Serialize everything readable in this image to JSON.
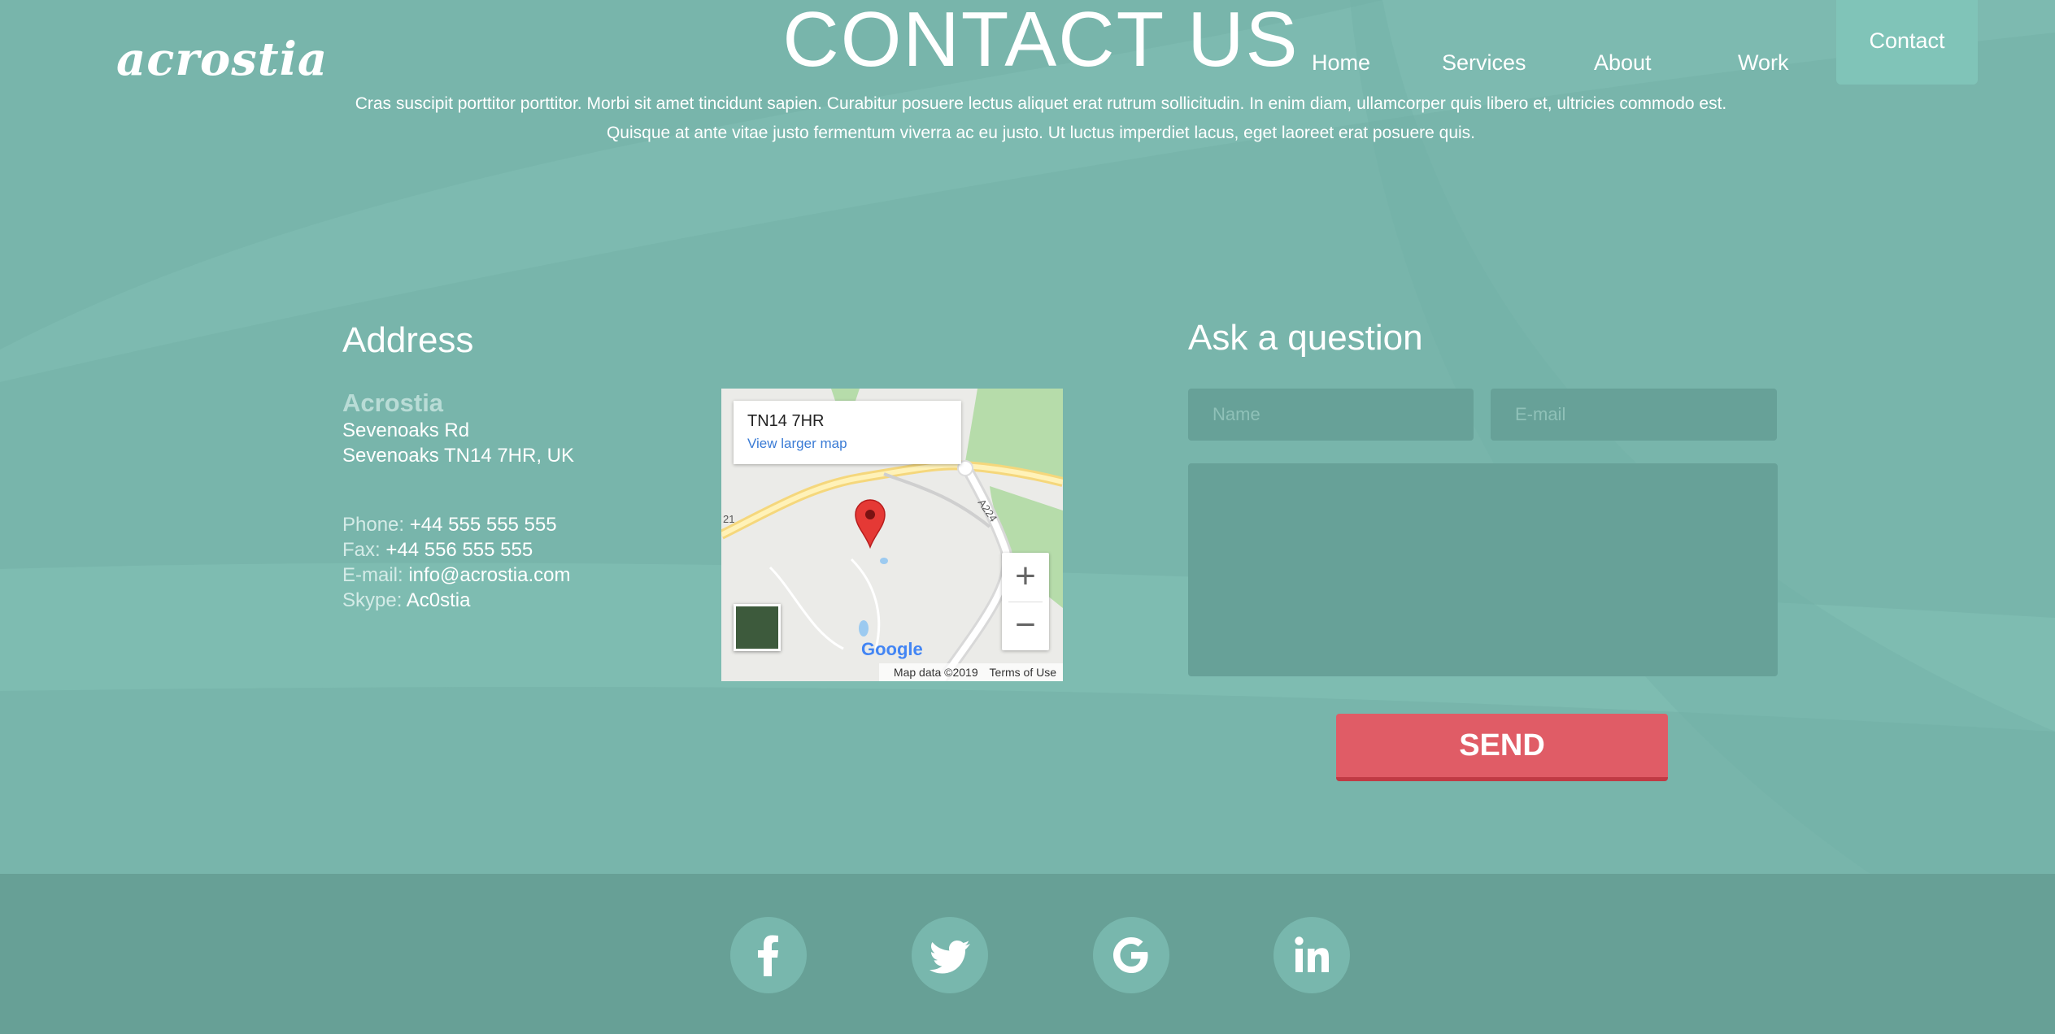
{
  "header": {
    "logo": "acrostia",
    "title": "CONTACT US",
    "intro_line1": "Cras suscipit porttitor porttitor. Morbi sit amet tincidunt sapien. Curabitur posuere lectus aliquet erat rutrum sollicitudin. In enim diam, ullamcorper quis libero et, ultricies commodo est.",
    "intro_line2": "Quisque at ante vitae justo fermentum viverra ac eu justo. Ut luctus imperdiet lacus, eget laoreet erat posuere quis."
  },
  "nav": {
    "items": [
      "Home",
      "Services",
      "About",
      "Work"
    ],
    "active": "Contact"
  },
  "address": {
    "heading": "Address",
    "company": "Acrostia",
    "street": "Sevenoaks Rd",
    "city": "Sevenoaks TN14 7HR, UK",
    "phone_label": "Phone:",
    "phone": "+44 555 555 555",
    "fax_label": "Fax:",
    "fax": "+44 556 555 555",
    "email_label": "E-mail:",
    "email": "info@acrostia.com",
    "skype_label": "Skype:",
    "skype": "Ac0stia"
  },
  "map": {
    "place": "TN14 7HR",
    "larger_link": "View larger map",
    "zoom_in": "+",
    "zoom_out": "−",
    "road_a224": "A224",
    "road_21": "21",
    "google": "Google",
    "map_data": "Map data ©2019",
    "terms": "Terms of Use"
  },
  "form": {
    "heading": "Ask a question",
    "name_placeholder": "Name",
    "email_placeholder": "E-mail",
    "message_placeholder": "",
    "send_label": "SEND"
  },
  "footer": {
    "social_icons": [
      "facebook-icon",
      "twitter-icon",
      "google-icon",
      "linkedin-icon"
    ]
  },
  "colors": {
    "background": "#78b5ab",
    "footer": "#67a096",
    "field": "#67a198",
    "send": "#e05c66",
    "nav_active": "#80c4b8"
  }
}
